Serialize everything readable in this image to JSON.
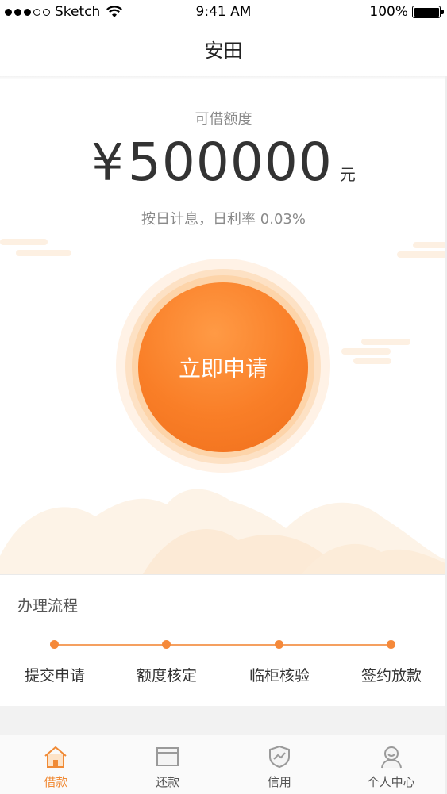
{
  "status_bar": {
    "carrier": "Sketch",
    "time": "9:41 AM",
    "battery": "100%"
  },
  "nav": {
    "title": "安田"
  },
  "hero": {
    "credit_label": "可借额度",
    "currency": "¥",
    "amount": "500000",
    "unit": "元",
    "rate_text": "按日计息，日利率 0.03%",
    "apply_label": "立即申请"
  },
  "process": {
    "title": "办理流程",
    "steps": [
      "提交申请",
      "额度核定",
      "临柜核验",
      "签约放款"
    ]
  },
  "tabs": [
    {
      "label": "借款",
      "icon": "home-icon",
      "active": true
    },
    {
      "label": "还款",
      "icon": "card-icon",
      "active": false
    },
    {
      "label": "信用",
      "icon": "shield-icon",
      "active": false
    },
    {
      "label": "个人中心",
      "icon": "user-icon",
      "active": false
    }
  ],
  "colors": {
    "accent": "#f5893a",
    "tab_active": "#f08a35"
  }
}
